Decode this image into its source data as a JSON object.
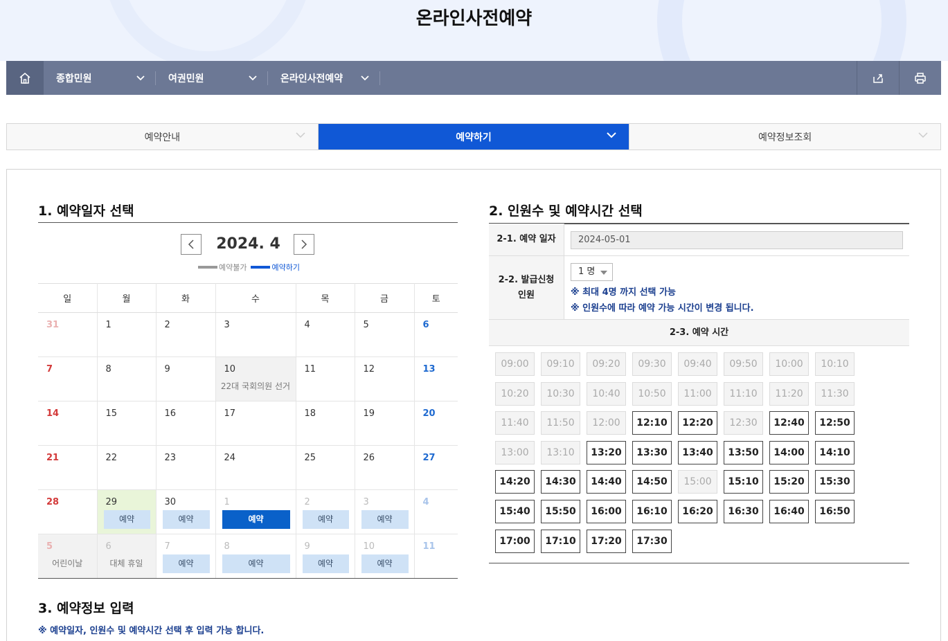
{
  "page_title": "온라인사전예약",
  "gnb": {
    "home_icon": "home-icon",
    "menus": [
      "종합민원",
      "여권민원",
      "온라인사전예약"
    ],
    "tools": [
      "share-icon",
      "print-icon"
    ]
  },
  "tabs": [
    {
      "label": "예약안내",
      "active": false
    },
    {
      "label": "예약하기",
      "active": true
    },
    {
      "label": "예약정보조회",
      "active": false
    }
  ],
  "section1": {
    "title": "1. 예약일자 선택",
    "month": "2024. 4",
    "legend_unavailable": "예약불가",
    "legend_available": "예약하기",
    "weekdays": [
      "일",
      "월",
      "화",
      "수",
      "목",
      "금",
      "토"
    ],
    "weeks": [
      [
        {
          "d": "31",
          "c": "prev"
        },
        {
          "d": "1"
        },
        {
          "d": "2"
        },
        {
          "d": "3"
        },
        {
          "d": "4"
        },
        {
          "d": "5"
        },
        {
          "d": "6",
          "c": "sat"
        }
      ],
      [
        {
          "d": "7",
          "c": "sun"
        },
        {
          "d": "8"
        },
        {
          "d": "9"
        },
        {
          "d": "10",
          "c": "hol",
          "note": "22대 국회의원 선거"
        },
        {
          "d": "11"
        },
        {
          "d": "12"
        },
        {
          "d": "13",
          "c": "sat"
        }
      ],
      [
        {
          "d": "14",
          "c": "sun"
        },
        {
          "d": "15"
        },
        {
          "d": "16"
        },
        {
          "d": "17"
        },
        {
          "d": "18"
        },
        {
          "d": "19"
        },
        {
          "d": "20",
          "c": "sat"
        }
      ],
      [
        {
          "d": "21",
          "c": "sun"
        },
        {
          "d": "22"
        },
        {
          "d": "23"
        },
        {
          "d": "24"
        },
        {
          "d": "25"
        },
        {
          "d": "26"
        },
        {
          "d": "27",
          "c": "sat"
        }
      ],
      [
        {
          "d": "28",
          "c": "sun"
        },
        {
          "d": "29",
          "c": "today",
          "btn": "예약"
        },
        {
          "d": "30",
          "btn": "예약"
        },
        {
          "d": "1",
          "c": "muted",
          "btn": "예약",
          "sel": true
        },
        {
          "d": "2",
          "c": "muted",
          "btn": "예약"
        },
        {
          "d": "3",
          "c": "muted",
          "btn": "예약"
        },
        {
          "d": "4",
          "c": "muted sat"
        }
      ],
      [
        {
          "d": "5",
          "c": "muted sun hol",
          "note": "어린이날"
        },
        {
          "d": "6",
          "c": "muted hol",
          "note": "대체 휴일"
        },
        {
          "d": "7",
          "c": "muted",
          "btn": "예약"
        },
        {
          "d": "8",
          "c": "muted",
          "btn": "예약"
        },
        {
          "d": "9",
          "c": "muted",
          "btn": "예약"
        },
        {
          "d": "10",
          "c": "muted",
          "btn": "예약"
        },
        {
          "d": "11",
          "c": "muted sat"
        }
      ]
    ]
  },
  "section2": {
    "title": "2. 인원수 및 예약시간 선택",
    "date_label": "2-1. 예약 일자",
    "date_value": "2024-05-01",
    "people_label_1": "2-2. 발급신청",
    "people_label_2": "인원",
    "people_value": "1 명",
    "hint1": "※ 최대 4명 까지 선택 가능",
    "hint2": "※ 인원수에 따라 예약 가능 시간이 변경 됩니다.",
    "time_title": "2-3. 예약 시간",
    "slots": [
      {
        "t": "09:00",
        "on": false
      },
      {
        "t": "09:10",
        "on": false
      },
      {
        "t": "09:20",
        "on": false
      },
      {
        "t": "09:30",
        "on": false
      },
      {
        "t": "09:40",
        "on": false
      },
      {
        "t": "09:50",
        "on": false
      },
      {
        "t": "10:00",
        "on": false
      },
      {
        "t": "10:10",
        "on": false
      },
      {
        "t": "10:20",
        "on": false
      },
      {
        "t": "10:30",
        "on": false
      },
      {
        "t": "10:40",
        "on": false
      },
      {
        "t": "10:50",
        "on": false
      },
      {
        "t": "11:00",
        "on": false
      },
      {
        "t": "11:10",
        "on": false
      },
      {
        "t": "11:20",
        "on": false
      },
      {
        "t": "11:30",
        "on": false
      },
      {
        "t": "11:40",
        "on": false
      },
      {
        "t": "11:50",
        "on": false
      },
      {
        "t": "12:00",
        "on": false
      },
      {
        "t": "12:10",
        "on": true
      },
      {
        "t": "12:20",
        "on": true
      },
      {
        "t": "12:30",
        "on": false
      },
      {
        "t": "12:40",
        "on": true
      },
      {
        "t": "12:50",
        "on": true
      },
      {
        "t": "13:00",
        "on": false
      },
      {
        "t": "13:10",
        "on": false
      },
      {
        "t": "13:20",
        "on": true
      },
      {
        "t": "13:30",
        "on": true
      },
      {
        "t": "13:40",
        "on": true
      },
      {
        "t": "13:50",
        "on": true
      },
      {
        "t": "14:00",
        "on": true
      },
      {
        "t": "14:10",
        "on": true
      },
      {
        "t": "14:20",
        "on": true
      },
      {
        "t": "14:30",
        "on": true
      },
      {
        "t": "14:40",
        "on": true
      },
      {
        "t": "14:50",
        "on": true
      },
      {
        "t": "15:00",
        "on": false
      },
      {
        "t": "15:10",
        "on": true
      },
      {
        "t": "15:20",
        "on": true
      },
      {
        "t": "15:30",
        "on": true
      },
      {
        "t": "15:40",
        "on": true
      },
      {
        "t": "15:50",
        "on": true
      },
      {
        "t": "16:00",
        "on": true
      },
      {
        "t": "16:10",
        "on": true
      },
      {
        "t": "16:20",
        "on": true
      },
      {
        "t": "16:30",
        "on": true
      },
      {
        "t": "16:40",
        "on": true
      },
      {
        "t": "16:50",
        "on": true
      },
      {
        "t": "17:00",
        "on": true
      },
      {
        "t": "17:10",
        "on": true
      },
      {
        "t": "17:20",
        "on": true
      },
      {
        "t": "17:30",
        "on": true
      }
    ]
  },
  "section3": {
    "title": "3. 예약정보 입력",
    "note": "※ 예약일자, 인원수 및 예약시간 선택 후 입력 가능 합니다."
  }
}
